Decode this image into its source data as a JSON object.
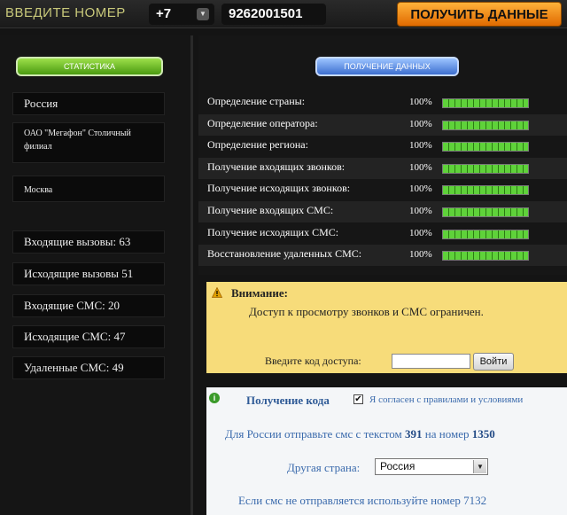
{
  "topbar": {
    "title": "ВВЕДИТЕ НОМЕР",
    "country_code": "+7",
    "phone": "9262001501",
    "get_button": "ПОЛУЧИТЬ ДАННЫЕ"
  },
  "left": {
    "stats_button": "СТАТИСТИКА",
    "country": "Россия",
    "operator": "ОАО \"Мегафон\" Столичный филиал",
    "region": "Москва",
    "incoming_calls": "Входящие вызовы: 63",
    "outgoing_calls": "Исходящие вызовы 51",
    "incoming_sms": "Входящие СМС: 20",
    "outgoing_sms": "Исходящие СМС: 47",
    "deleted_sms": "Удаленные СМС: 49"
  },
  "right": {
    "data_button": "ПОЛУЧЕНИЕ ДАННЫХ",
    "progress": [
      {
        "label": "Определение страны:",
        "pct": "100%",
        "value": 1.0
      },
      {
        "label": "Определение оператора:",
        "pct": "100%",
        "value": 1.0
      },
      {
        "label": "Определение региона:",
        "pct": "100%",
        "value": 1.0
      },
      {
        "label": "Получение входящих звонков:",
        "pct": "100%",
        "value": 1.0
      },
      {
        "label": "Получение исходящих звонков:",
        "pct": "100%",
        "value": 1.0
      },
      {
        "label": "Получение входящих СМС:",
        "pct": "100%",
        "value": 1.0
      },
      {
        "label": "Получение исходящих СМС:",
        "pct": "100%",
        "value": 1.0
      },
      {
        "label": "Восстановление удаленных СМС:",
        "pct": "100%",
        "value": 1.0
      }
    ]
  },
  "warning": {
    "title": "Внимание:",
    "text": "Доступ к просмотру звонков и СМС ограничен.",
    "access_label": "Введите код доступа:",
    "access_value": "",
    "login_button": "Войти"
  },
  "code": {
    "title": "Получение кода",
    "agree_checked": true,
    "agree_text": "Я согласен с правилами и условиями",
    "sms_prefix": "Для России отправьте смс с текстом",
    "sms_text": "391",
    "sms_mid": "на номер",
    "sms_number": "1350",
    "country_label": "Другая страна:",
    "country_value": "Россия",
    "bottom_text": "Если смс не отправляется используйте номер 7132"
  },
  "colors": {
    "accent_orange": "#f08a10",
    "accent_green": "#5fd23a",
    "accent_blue": "#3d6fcf",
    "warning_bg": "#f7dc7a"
  }
}
